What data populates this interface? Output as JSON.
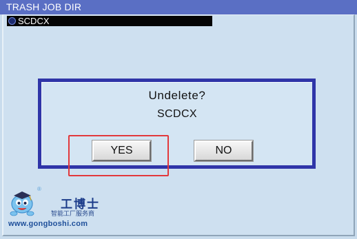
{
  "window": {
    "title": "TRASH JOB DIR"
  },
  "job_list": {
    "items": [
      {
        "name": "SCDCX",
        "selected": true
      }
    ]
  },
  "dialog": {
    "question": "Undelete?",
    "job_name": "SCDCX",
    "yes_label": "YES",
    "no_label": "NO"
  },
  "annotation": {
    "color": "#e2383b"
  },
  "watermark": {
    "brand_cn": "工博士",
    "tagline_cn": "智能工厂服务商",
    "url": "www.gongboshi.com",
    "registered_mark": "®"
  },
  "colors": {
    "title_bar": "#5a6fc4",
    "background": "#c9dced",
    "dialog_border": "#2f35a8",
    "selected_row": "#050505"
  }
}
